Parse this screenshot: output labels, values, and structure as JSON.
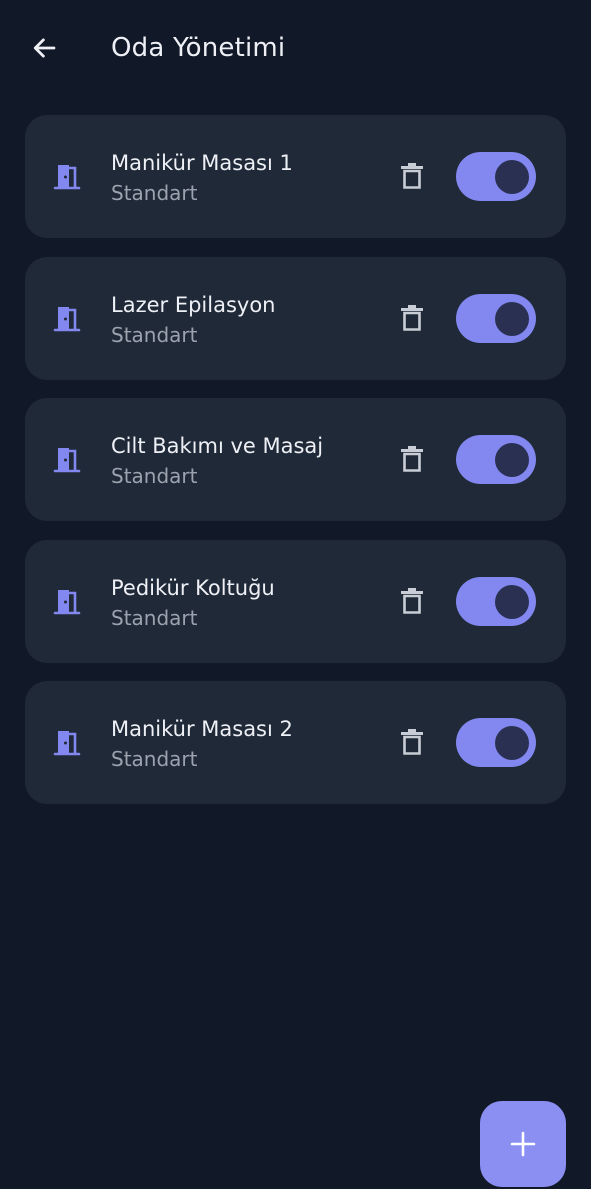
{
  "header": {
    "title": "Oda Yönetimi",
    "back_icon": "arrow-left-icon"
  },
  "theme": {
    "background": "#111827",
    "card": "#1f2937",
    "accent": "#8288ef",
    "knob": "#2a3052",
    "text_primary": "#eef0f6",
    "text_secondary": "#9ca3af"
  },
  "rooms": [
    {
      "name": "Manikür Masası 1",
      "type": "Standart",
      "icon": "door-icon",
      "active": true
    },
    {
      "name": "Lazer Epilasyon",
      "type": "Standart",
      "icon": "door-icon",
      "active": true
    },
    {
      "name": "Cilt Bakımı ve Masaj",
      "type": "Standart",
      "icon": "door-icon",
      "active": true
    },
    {
      "name": "Pedikür Koltuğu",
      "type": "Standart",
      "icon": "door-icon",
      "active": true
    },
    {
      "name": "Manikür Masası 2",
      "type": "Standart",
      "icon": "door-icon",
      "active": true
    }
  ],
  "fab": {
    "icon": "plus-icon"
  }
}
